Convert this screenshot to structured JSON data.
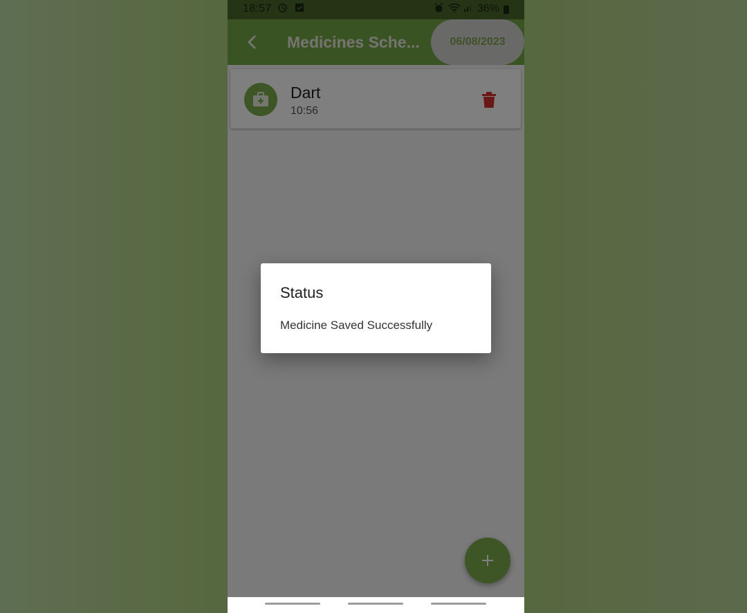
{
  "status_bar": {
    "time": "18:57",
    "battery": "36%",
    "icons": [
      "clock-icon",
      "checkbox-icon",
      "alarm-icon",
      "wifi-icon",
      "signal-icon",
      "battery-icon"
    ]
  },
  "app_bar": {
    "title": "Medicines Sche...",
    "date": "06/08/2023",
    "back_icon": "chevron-left-icon"
  },
  "medicines": [
    {
      "name": "Dart",
      "time": "10:56",
      "icon": "medical-kit-icon"
    }
  ],
  "fab": {
    "icon": "plus-icon"
  },
  "dialog": {
    "title": "Status",
    "message": "Medicine Saved Successfully"
  },
  "colors": {
    "primary": "#72a844",
    "status_bar": "#48682a",
    "accent_green": "#7cac4b",
    "delete_red": "#d32f2f",
    "date_text": "#7fa24c"
  }
}
